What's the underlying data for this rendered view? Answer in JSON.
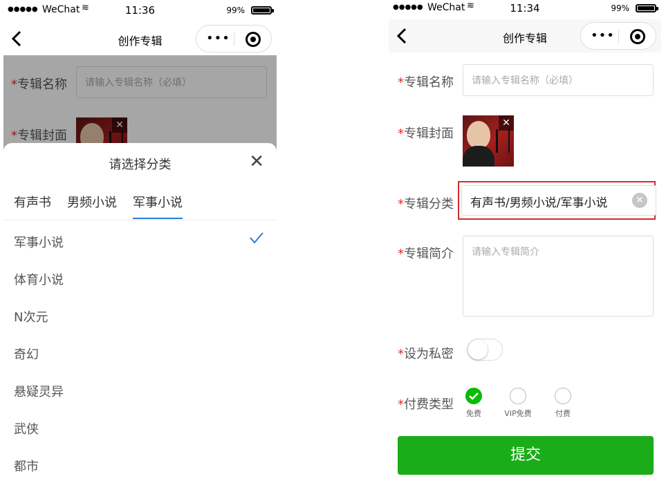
{
  "status_bar": {
    "carrier": "WeChat",
    "battery": "99%",
    "left_time": "11:36",
    "right_time": "11:34"
  },
  "nav": {
    "title": "创作专辑"
  },
  "form": {
    "album_name_label": "专辑名称",
    "album_name_placeholder": "请输入专辑名称（必填）",
    "album_cover_label": "专辑封面",
    "album_category_label": "专辑分类",
    "album_category_value": "有声书/男频小说/军事小说",
    "album_intro_label": "专辑简介",
    "album_intro_placeholder": "请输入专辑简介",
    "private_label": "设为私密",
    "payment_label": "付费类型",
    "payment_options": [
      "免费",
      "VIP免费",
      "付费"
    ],
    "submit_label": "提交",
    "required_mark": "*"
  },
  "sheet": {
    "title": "请选择分类",
    "tabs": [
      "有声书",
      "男频小说",
      "军事小说"
    ],
    "options": [
      "军事小说",
      "体育小说",
      "N次元",
      "奇幻",
      "悬疑灵异",
      "武侠",
      "都市"
    ]
  },
  "colors": {
    "required": "#e32d2d",
    "submit": "#1aad19",
    "tab_active": "#2a7bd6",
    "highlight": "#d42a2a"
  }
}
